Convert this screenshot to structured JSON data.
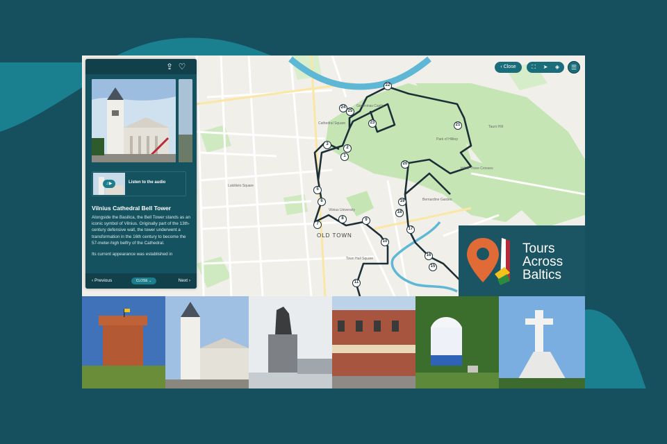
{
  "panel": {
    "audio_label": "Listen to the audio",
    "title": "Vilnius Cathedral Bell Tower",
    "description_1": "Alongside the Basilica, the Bell Tower stands as an iconic symbol of Vilnius. Originally part of the 13th-century defensive wall, the tower underwent a transformation in the 16th century to become the 57-meter-high belfry of the Cathedral.",
    "description_2": "Its current appearance was established in",
    "prev_label": "Previous",
    "close_label": "CLOSE",
    "next_label": "Next"
  },
  "map_controls": {
    "close_label": "Close"
  },
  "map": {
    "area_label": "OLD TOWN",
    "markers": [
      "22",
      "24",
      "25",
      "23",
      "21",
      "3",
      "2",
      "1",
      "20",
      "19",
      "18",
      "17",
      "16",
      "15",
      "5",
      "6",
      "7",
      "8",
      "9",
      "10",
      "11"
    ],
    "place_labels": [
      "Tauro Hill",
      "Hill of Three Crosses",
      "Gediminas Castle",
      "Park of Hilltop",
      "Bernardine Garden",
      "Vilnius University",
      "Town Hall Square",
      "Cathedral Square",
      "Lukiškės Square"
    ]
  },
  "brand": {
    "line1": "Tours",
    "line2": "Across",
    "line3": "Baltics"
  },
  "colors": {
    "background": "#16505f",
    "panel": "#15525f",
    "accent": "#1b6d7c",
    "river": "#5fb7d6",
    "route": "#1c2f38",
    "park": "#c5e6b4"
  },
  "icons": {
    "share": "share-icon",
    "favorite": "heart-icon",
    "play": "play-icon",
    "menu": "menu-icon"
  }
}
